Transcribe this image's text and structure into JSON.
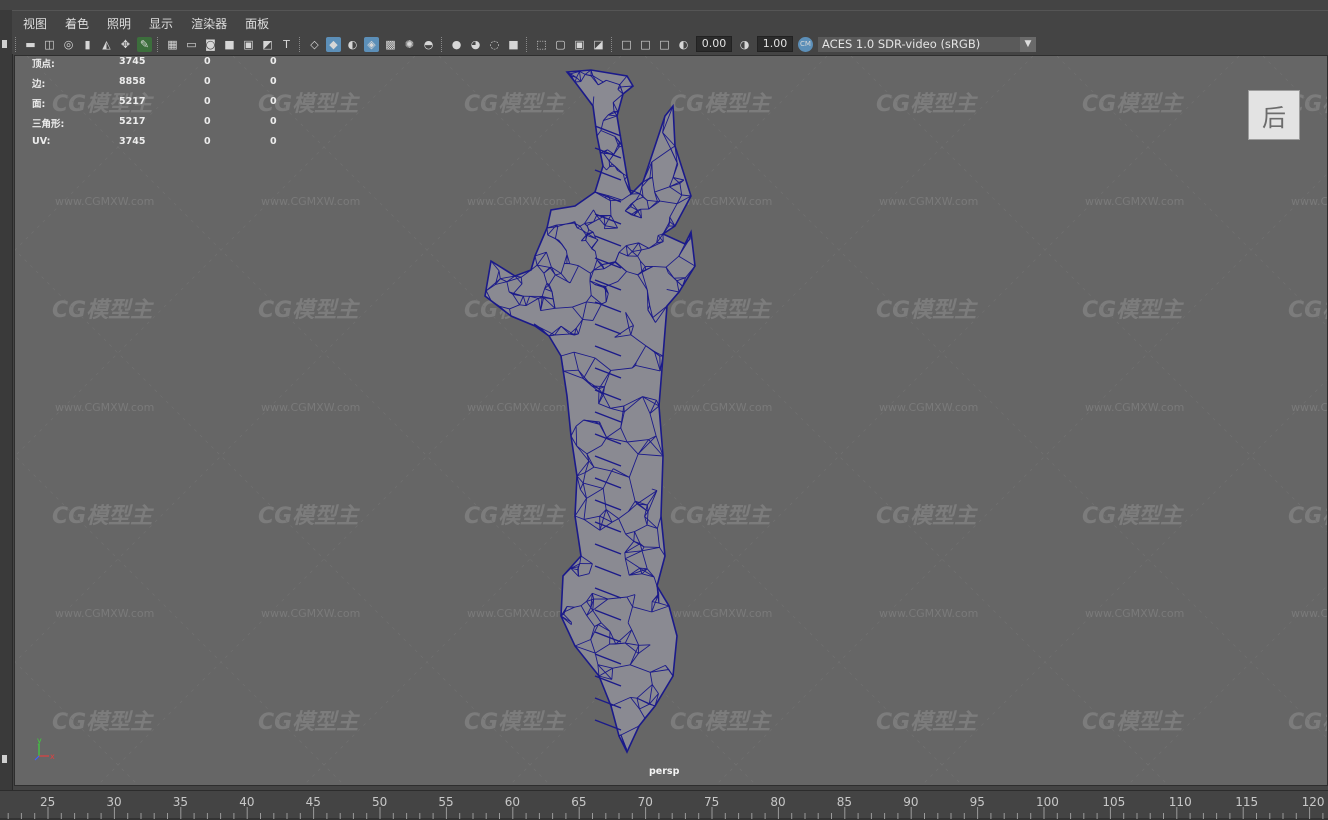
{
  "menubar": {
    "items": [
      {
        "id": "view",
        "label": "视图"
      },
      {
        "id": "shading",
        "label": "着色"
      },
      {
        "id": "lighting",
        "label": "照明"
      },
      {
        "id": "show",
        "label": "显示"
      },
      {
        "id": "renderer",
        "label": "渲染器"
      },
      {
        "id": "panels",
        "label": "面板"
      }
    ]
  },
  "toolbar": {
    "exposure_value": "0.00",
    "gamma_value": "1.00",
    "color_space": "ACES 1.0 SDR-video (sRGB)",
    "icons": [
      "select-camera-icon",
      "camera-attributes-icon",
      "bookmarks-icon",
      "bookmark-icon",
      "image-plane-icon",
      "2d-pan-zoom-icon",
      "grease-pencil-icon",
      "sep",
      "grid-icon",
      "film-gate-icon",
      "resolution-gate-icon",
      "gate-mask-icon",
      "field-chart-icon",
      "safe-action-icon",
      "safe-title-icon",
      "sep",
      "wireframe-icon",
      "smooth-shade-all-icon",
      "default-material-icon",
      "wireframe-on-shaded-icon",
      "textured-icon",
      "use-all-lights-icon",
      "shadows-icon",
      "sep",
      "screen-space-ao-icon",
      "motion-blur-icon",
      "multisample-aa-icon",
      "depth-of-field-icon",
      "sep",
      "isolate-select-icon",
      "xray-icon",
      "xray-active-components-icon",
      "xray-joints-icon",
      "sep",
      "exposure-icon",
      "gamma-icon",
      "color-management-icon"
    ]
  },
  "hud": {
    "rows": [
      {
        "label": "顶点:",
        "values": [
          "3745",
          "0",
          "0"
        ]
      },
      {
        "label": "边:",
        "values": [
          "8858",
          "0",
          "0"
        ]
      },
      {
        "label": "面:",
        "values": [
          "5217",
          "0",
          "0"
        ]
      },
      {
        "label": "三角形:",
        "values": [
          "5217",
          "0",
          "0"
        ]
      },
      {
        "label": "UV:",
        "values": [
          "3745",
          "0",
          "0"
        ]
      }
    ]
  },
  "viewcube": {
    "face_label": "后"
  },
  "camera": {
    "name": "persp"
  },
  "axis": {
    "y_label": "y",
    "x_label": "x"
  },
  "watermark": {
    "logo": "CG模型主",
    "url": "www.CGMXW.com"
  },
  "timeline": {
    "ticks": [
      "25",
      "30",
      "35",
      "40",
      "45",
      "50",
      "55",
      "60",
      "65",
      "70",
      "75",
      "80",
      "85",
      "90",
      "95",
      "100",
      "105",
      "110",
      "115",
      "120"
    ]
  },
  "colors": {
    "viewport_bg": "#666666",
    "wire": "#1b1a8a",
    "mesh_fill": "#8a8a92",
    "active_icon": "#5c8fb8"
  }
}
